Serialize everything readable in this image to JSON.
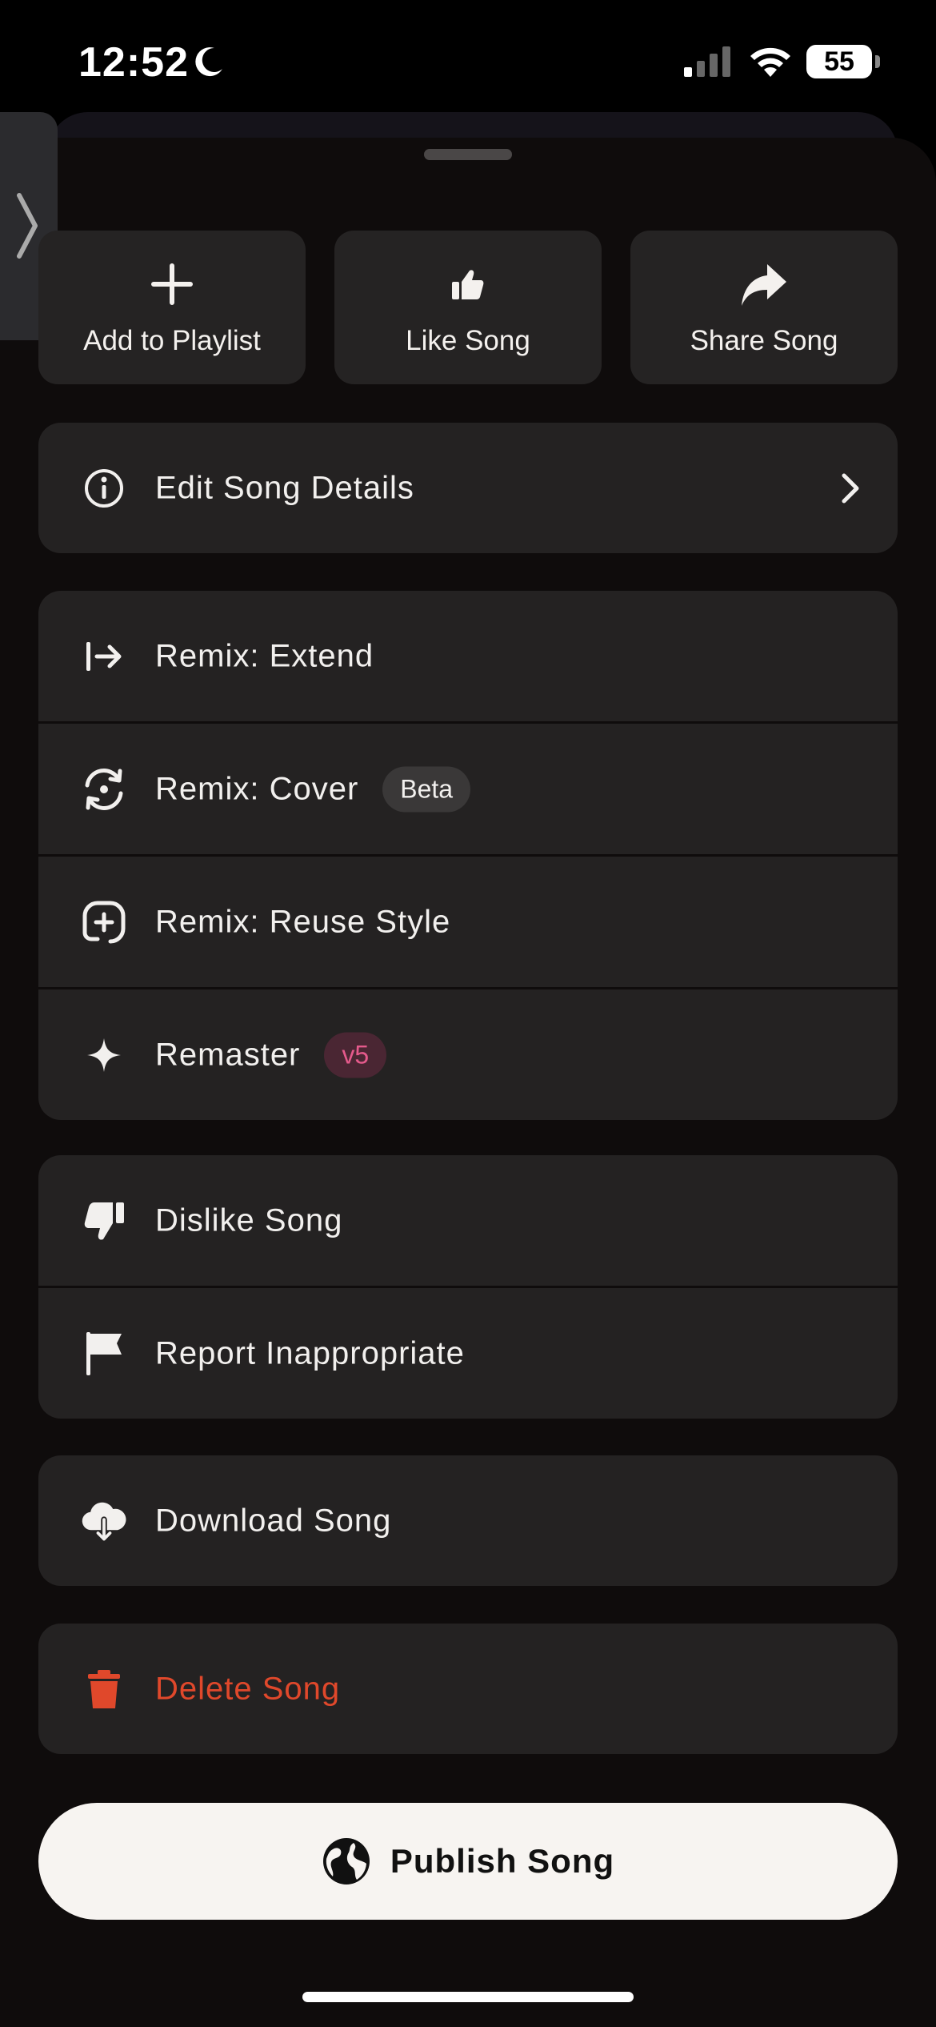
{
  "status_bar": {
    "time": "12:52",
    "battery": "55"
  },
  "top_actions": [
    {
      "label": "Add to Playlist",
      "icon": "plus-icon"
    },
    {
      "label": "Like Song",
      "icon": "thumbs-up-icon"
    },
    {
      "label": "Share Song",
      "icon": "share-arrow-icon"
    }
  ],
  "edit_details": {
    "label": "Edit Song Details",
    "icon": "info-icon"
  },
  "remix_group": {
    "extend": {
      "label": "Remix: Extend",
      "icon": "extend-arrow-icon"
    },
    "cover": {
      "label": "Remix: Cover",
      "badge": "Beta",
      "icon": "cover-cycle-icon"
    },
    "reuse_style": {
      "label": "Remix: Reuse Style",
      "icon": "reuse-style-icon"
    },
    "remaster": {
      "label": "Remaster",
      "badge": "v5",
      "icon": "sparkle-icon"
    }
  },
  "feedback_group": {
    "dislike": {
      "label": "Dislike Song",
      "icon": "thumbs-down-icon"
    },
    "report": {
      "label": "Report Inappropriate",
      "icon": "flag-icon"
    }
  },
  "download": {
    "label": "Download Song",
    "icon": "cloud-download-icon"
  },
  "delete": {
    "label": "Delete Song",
    "icon": "trash-icon"
  },
  "publish": {
    "label": "Publish Song",
    "icon": "globe-icon"
  },
  "colors": {
    "danger": "#e0482b",
    "badge_pink": "#e55a8c",
    "sheet": "#0f0c0c",
    "card": "#242222"
  }
}
